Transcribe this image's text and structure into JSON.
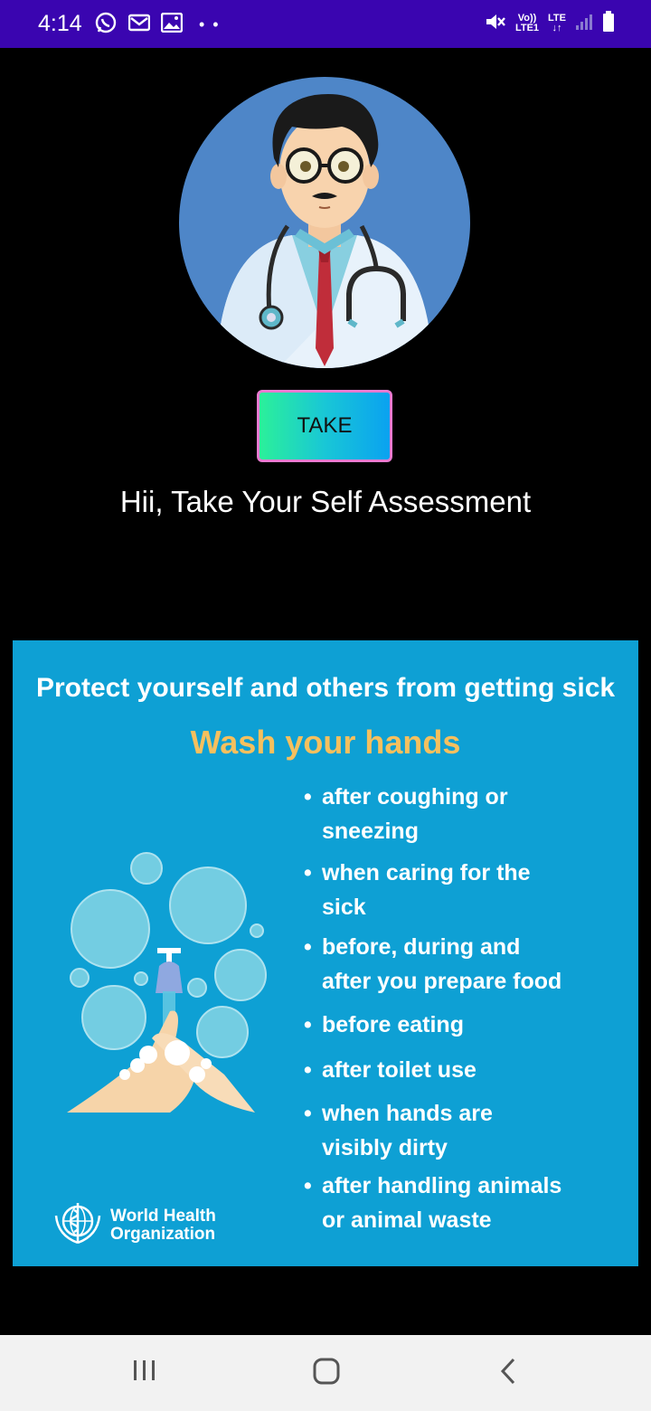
{
  "status_bar": {
    "time": "4:14",
    "left_icons": [
      "whatsapp-icon",
      "gmail-icon",
      "gallery-icon"
    ],
    "dots": "• •",
    "network": {
      "volte": "Vo))",
      "lte1": "LTE1",
      "lte": "LTE"
    },
    "right_icons": [
      "mute-icon",
      "signal-icon",
      "battery-icon"
    ]
  },
  "header": {
    "avatar_alt": "doctor-avatar",
    "take_button_label": "TAKE",
    "assessment_prompt": "Hii, Take Your Self Assessment"
  },
  "poster": {
    "headline": "Protect yourself and others from getting sick",
    "subtitle": "Wash your hands",
    "tips": [
      {
        "line1": "after coughing or",
        "line2": "sneezing"
      },
      {
        "line1": "when caring for the",
        "line2": "sick"
      },
      {
        "line1": "before, during and",
        "line2": "after you prepare food"
      },
      {
        "line1": "before eating",
        "line2": ""
      },
      {
        "line1": "after toilet use",
        "line2": ""
      },
      {
        "line1": "when hands are",
        "line2": "visibly dirty"
      },
      {
        "line1": "after handling animals",
        "line2": "or animal waste"
      }
    ],
    "logo_line1": "World Health",
    "logo_line2": "Organization",
    "colors": {
      "background": "#0ea0d4",
      "subtitle": "#f6c05e"
    }
  },
  "nav_bar": {
    "buttons": [
      "recent-apps-icon",
      "home-icon",
      "back-icon"
    ]
  }
}
